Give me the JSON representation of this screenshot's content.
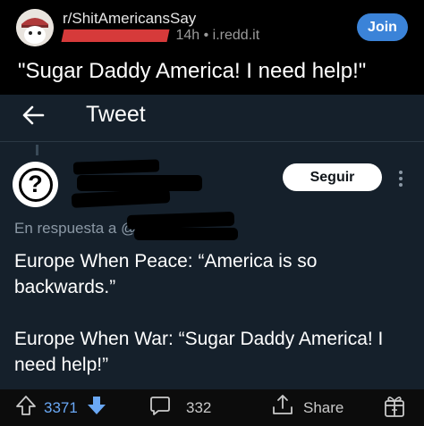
{
  "post": {
    "subreddit": "r/ShitAmericansSay",
    "age": "14h",
    "separator": "•",
    "domain": "i.redd.it",
    "join_label": "Join",
    "title": "\"Sugar Daddy America! I need help!\""
  },
  "tweet": {
    "header": "Tweet",
    "follow_label": "Seguir",
    "reply_prefix": "En respuesta a @",
    "lines": [
      "Europe When Peace: “America is so backwards.”",
      "Europe When War: “Sugar Daddy America! I need help!”"
    ]
  },
  "actions": {
    "upvotes": "3371",
    "comments": "332",
    "share_label": "Share"
  },
  "colors": {
    "join": "#3b83d8",
    "upvote": "#6aa8f5",
    "tweet_bg": "#15202b",
    "handle": "#1d9bf0"
  },
  "icons": [
    "back-arrow-icon",
    "more-icon",
    "upvote-icon",
    "downvote-icon",
    "comment-icon",
    "share-icon",
    "award-icon"
  ]
}
